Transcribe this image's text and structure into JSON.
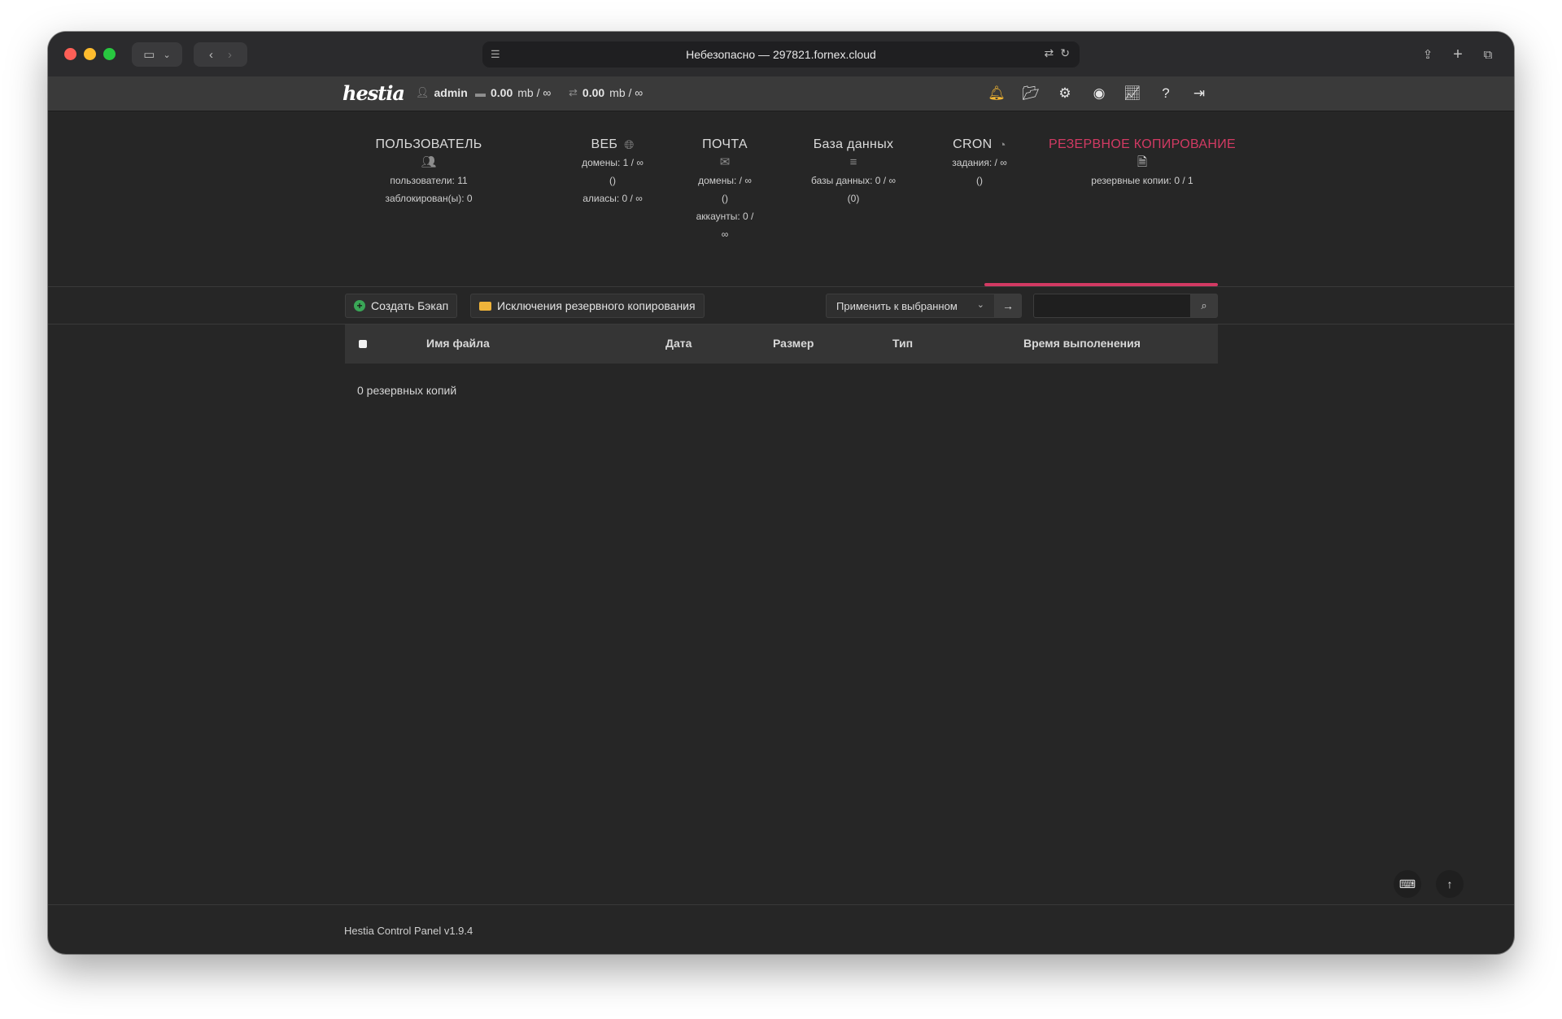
{
  "browser": {
    "url_text": "Небезопасно — 297821.fornex.cloud",
    "icons": [
      "sidebar-icon",
      "chevron-down-icon",
      "back-icon",
      "forward-icon",
      "reader-icon",
      "translate-icon",
      "reload-icon",
      "share-icon",
      "new-tab-icon",
      "tabs-overview-icon"
    ]
  },
  "header": {
    "logo": "hestia",
    "user": "admin",
    "disk": "0.00",
    "disk_unit": "mb / ∞",
    "bandwidth": "0.00",
    "bandwidth_unit": "mb / ∞",
    "icons": [
      "bell-icon",
      "folder-icon",
      "gear-icon",
      "user-circle-icon",
      "chart-icon",
      "help-icon",
      "logout-icon"
    ]
  },
  "stats": {
    "user": {
      "title": "ПОЛЬЗОВАТЕЛЬ",
      "lines": [
        "пользователи: 11",
        "заблокирован(ы): 0"
      ]
    },
    "web": {
      "title": "ВЕБ",
      "lines": [
        "домены: 1 / ∞",
        "()",
        "алиасы: 0 / ∞"
      ]
    },
    "mail": {
      "title": "ПОЧТА",
      "lines": [
        "домены: / ∞",
        "()",
        "аккаунты: 0 /",
        "∞"
      ]
    },
    "db": {
      "title": "База данных",
      "lines": [
        "базы данных: 0 / ∞",
        "(0)"
      ]
    },
    "cron": {
      "title": "CRON",
      "lines": [
        "задания: / ∞",
        "()"
      ]
    },
    "backup": {
      "title": "РЕЗЕРВНОЕ КОПИРОВАНИЕ",
      "lines": [
        "резервные копии: 0 / 1"
      ]
    }
  },
  "toolbar": {
    "create_backup": "Создать Бэкап",
    "exclusions": "Исключения резервного копирования",
    "bulk_select": "Применить к выбранном",
    "search_value": ""
  },
  "table": {
    "headers": {
      "filename": "Имя файла",
      "date": "Дата",
      "size": "Размер",
      "type": "Тип",
      "runtime": "Время выполенения"
    },
    "empty_text": "0 резервных копий"
  },
  "footer": {
    "version": "Hestia Control Panel v1.9.4"
  },
  "colors": {
    "accent": "#d23a63",
    "background": "#262626",
    "bell": "#f5b731",
    "add": "#3aa757"
  }
}
